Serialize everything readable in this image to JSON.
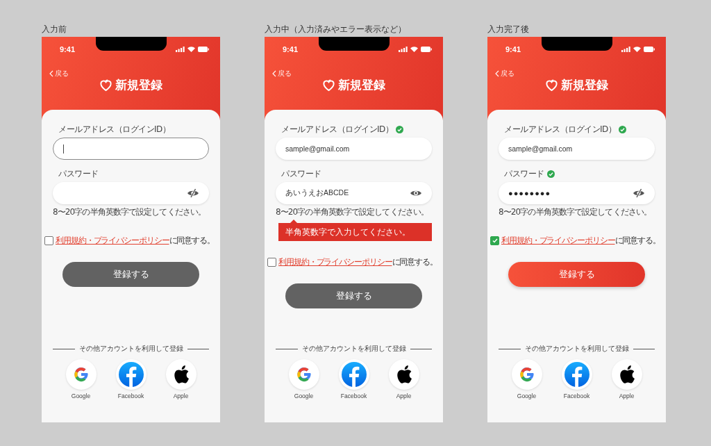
{
  "screens": [
    {
      "caption": "入力前",
      "status_time": "9:41",
      "back": "戻る",
      "title": "新規登録",
      "email": {
        "label": "メールアドレス（ログインID）",
        "valid": false,
        "focused": true
      },
      "password": {
        "label": "パスワード",
        "valid": false,
        "visible": false
      },
      "hint": "8〜20字の半角英数字で設定してください。",
      "agree": {
        "checked": false,
        "link": "利用規約・プライバシーポリシー",
        "rest": "に同意する。"
      },
      "submit": {
        "label": "登録する",
        "enabled": false
      },
      "alt_label": "その他アカウントを利用して登録",
      "providers": [
        {
          "name": "Google",
          "kind": "google"
        },
        {
          "name": "Facebook",
          "kind": "facebook"
        },
        {
          "name": "Apple",
          "kind": "apple"
        }
      ]
    },
    {
      "caption": "入力中（入力済みやエラー表示など）",
      "status_time": "9:41",
      "back": "戻る",
      "title": "新規登録",
      "email": {
        "label": "メールアドレス（ログインID）",
        "value": "sample@gmail.com",
        "valid": true,
        "focused": false
      },
      "password": {
        "label": "パスワード",
        "value": "あいうえおABCDE",
        "valid": false,
        "visible": true
      },
      "hint": "8〜20字の半角英数字で設定してください。",
      "error": "半角英数字で入力してください。",
      "agree": {
        "checked": false,
        "link": "利用規約・プライバシーポリシー",
        "rest": "に同意する。"
      },
      "submit": {
        "label": "登録する",
        "enabled": false
      },
      "alt_label": "その他アカウントを利用して登録",
      "providers": [
        {
          "name": "Google",
          "kind": "google"
        },
        {
          "name": "Facebook",
          "kind": "facebook"
        },
        {
          "name": "Apple",
          "kind": "apple"
        }
      ]
    },
    {
      "caption": "入力完了後",
      "status_time": "9:41",
      "back": "戻る",
      "title": "新規登録",
      "email": {
        "label": "メールアドレス（ログインID）",
        "value": "sample@gmail.com",
        "valid": true,
        "focused": false
      },
      "password": {
        "label": "パスワード",
        "value": "●●●●●●●●",
        "valid": true,
        "visible": false
      },
      "hint": "8〜20字の半角英数字で設定してください。",
      "agree": {
        "checked": true,
        "link": "利用規約・プライバシーポリシー",
        "rest": "に同意する。"
      },
      "submit": {
        "label": "登録する",
        "enabled": true
      },
      "alt_label": "その他アカウントを利用して登録",
      "providers": [
        {
          "name": "Google",
          "kind": "google"
        },
        {
          "name": "Facebook",
          "kind": "facebook"
        },
        {
          "name": "Apple",
          "kind": "apple"
        }
      ]
    }
  ]
}
